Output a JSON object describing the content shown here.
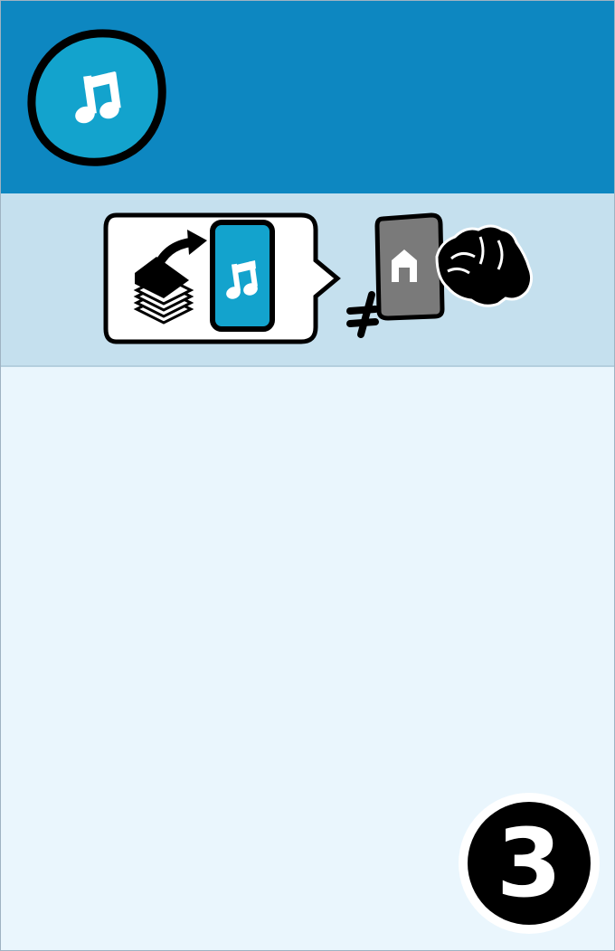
{
  "card": {
    "category_icon": "music-note-icon",
    "number": "3",
    "rule": {
      "icons": [
        "card-stack-icon",
        "curved-arrow-icon",
        "music-card-icon",
        "not-equal-icon",
        "home-card-icon",
        "grabbing-hand-icon"
      ]
    }
  },
  "colors": {
    "header": "#0d87c1",
    "badge": "#13a3cd",
    "rule_band": "#c5e0ee",
    "body": "#eaf6fd",
    "home_card": "#7a7a7a"
  }
}
